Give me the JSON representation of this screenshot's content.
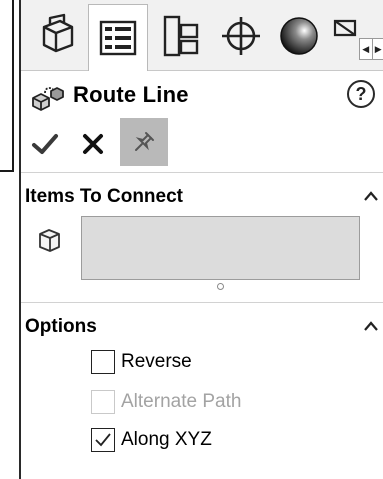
{
  "tabs": [
    {
      "name": "feature-manager",
      "icon": "feature-tree-icon",
      "active": false
    },
    {
      "name": "property-manager",
      "icon": "property-manager-icon",
      "active": true
    },
    {
      "name": "configuration-manager",
      "icon": "configuration-icon",
      "active": false
    },
    {
      "name": "dimxpert-manager",
      "icon": "crosshair-icon",
      "active": false
    },
    {
      "name": "display-manager",
      "icon": "appearance-sphere-icon",
      "active": false
    }
  ],
  "header": {
    "title": "Route Line",
    "help_label": "?"
  },
  "actions": {
    "ok_icon": "checkmark-icon",
    "cancel_icon": "x-icon",
    "pin_icon": "pushpin-icon"
  },
  "items_to_connect": {
    "title": "Items To Connect",
    "selection_value": ""
  },
  "options": {
    "title": "Options",
    "items": [
      {
        "label": "Reverse",
        "checked": false,
        "enabled": true
      },
      {
        "label": "Alternate Path",
        "checked": false,
        "enabled": false
      },
      {
        "label": "Along XYZ",
        "checked": true,
        "enabled": true
      }
    ]
  },
  "colors": {
    "panel_bg": "#ffffff",
    "tabbar_bg": "#f1f1f1",
    "selection_box": "#dcdcdc",
    "pin_active": "#b9b9b9",
    "disabled_text": "#a3a3a3"
  }
}
